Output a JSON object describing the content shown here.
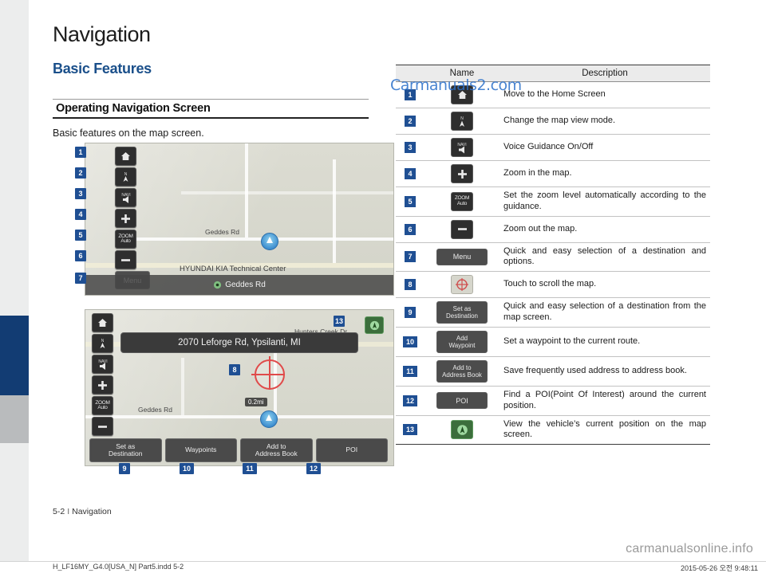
{
  "document": {
    "title": "Navigation",
    "section_title": "Basic Features",
    "subsection_title": "Operating Navigation Screen",
    "intro_text": "Basic features on the map screen.",
    "page_footer": "5-2",
    "page_footer_sep": "I",
    "page_footer_chapter": "Navigation",
    "file_footer_left": "H_LF16MY_G4.0[USA_N] Part5.indd   5-2",
    "file_footer_right": "2015-05-26   오전 9:48:11",
    "watermark_top": "Carmanuals2.com",
    "watermark_bottom": "carmanualsonline.info"
  },
  "table": {
    "headers": [
      "",
      "Name",
      "Description"
    ],
    "rows": [
      {
        "num": "1",
        "icon": "home-icon",
        "icon_text": "",
        "description": "Move to the Home Screen"
      },
      {
        "num": "2",
        "icon": "compass-north-icon",
        "icon_text": "N",
        "description": "Change the map view mode."
      },
      {
        "num": "3",
        "icon": "navi-voice-icon",
        "icon_text": "NAVI",
        "description": "Voice Guidance On/Off"
      },
      {
        "num": "4",
        "icon": "zoom-in-icon",
        "icon_text": "+",
        "description": "Zoom in the map."
      },
      {
        "num": "5",
        "icon": "auto-zoom-icon",
        "icon_text": "ZOOM Auto",
        "description": "Set the zoom level automatically according to the guidance."
      },
      {
        "num": "6",
        "icon": "zoom-out-icon",
        "icon_text": "–",
        "description": "Zoom out the map."
      },
      {
        "num": "7",
        "icon": "menu-button-icon",
        "icon_text": "Menu",
        "description": "Quick and easy selection of a destination and options."
      },
      {
        "num": "8",
        "icon": "scroll-cursor-icon",
        "icon_text": "",
        "description": "Touch to scroll the map."
      },
      {
        "num": "9",
        "icon": "set-as-destination-icon",
        "icon_text": "Set as\nDestination",
        "description": "Quick and easy selection of a destination from the map screen."
      },
      {
        "num": "10",
        "icon": "add-waypoint-icon",
        "icon_text": "Add\nWaypoint",
        "description": "Set a waypoint to the current route."
      },
      {
        "num": "11",
        "icon": "add-to-address-book-icon",
        "icon_text": "Add to\nAddress Book",
        "description": "Save frequently used address to address book."
      },
      {
        "num": "12",
        "icon": "poi-icon",
        "icon_text": "POI",
        "description": "Find a POI(Point Of Interest) around the current position."
      },
      {
        "num": "13",
        "icon": "current-position-icon",
        "icon_text": "",
        "description": "View the vehicle’s current position on the map screen."
      }
    ]
  },
  "map_screen_1": {
    "buttons": [
      {
        "badge": "1",
        "icon": "home-icon",
        "label": ""
      },
      {
        "badge": "2",
        "icon": "compass-north-icon",
        "label": "N"
      },
      {
        "badge": "3",
        "icon": "navi-voice-icon",
        "label": "NAVI"
      },
      {
        "badge": "4",
        "icon": "zoom-in-icon",
        "label": "+"
      },
      {
        "badge": "5",
        "icon": "auto-zoom-icon",
        "label": "ZOOM Auto"
      },
      {
        "badge": "6",
        "icon": "zoom-out-icon",
        "label": "–"
      }
    ],
    "menu_badge": "7",
    "menu_label": "Menu",
    "street_label_1": "Geddes Rd",
    "poi_label": "HYUNDAI KIA Technical Center",
    "bottom_bar_label": "Geddes Rd"
  },
  "map_screen_2": {
    "address_bar": "2070 Leforge Rd, Ypsilanti, MI",
    "street_label_top": "Hunters Creek Dr",
    "street_label_bottom": "Geddes Rd",
    "distance_chip": "0.2mi",
    "gps_badge": "13",
    "scroll_badge": "8",
    "bottom_buttons": [
      {
        "badge": "9",
        "label": "Set as\nDestination"
      },
      {
        "badge": "10",
        "label": "Waypoints"
      },
      {
        "badge": "11",
        "label": "Add to\nAddress Book"
      },
      {
        "badge": "12",
        "label": "POI"
      }
    ]
  }
}
